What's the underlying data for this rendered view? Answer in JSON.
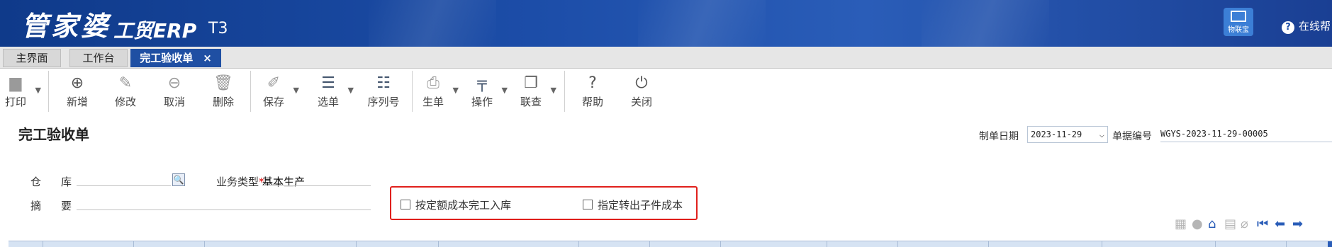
{
  "app": {
    "logo_main": "管家婆",
    "logo_sub": "工贸ERP",
    "logo_version": "T3",
    "iot_label": "物联宝",
    "online_help": "在线帮"
  },
  "tabs": [
    {
      "label": "主界面",
      "active": false
    },
    {
      "label": "工作台",
      "active": false
    },
    {
      "label": "完工验收单",
      "active": true,
      "close": "×"
    }
  ],
  "toolbar": [
    {
      "label": "打印",
      "icon": "printer-icon",
      "dropdown": true
    },
    {
      "label": "新增",
      "icon": "plus-circle-icon",
      "dropdown": false
    },
    {
      "label": "修改",
      "icon": "edit-icon",
      "dropdown": false
    },
    {
      "label": "取消",
      "icon": "minus-circle-icon",
      "dropdown": false
    },
    {
      "label": "删除",
      "icon": "trash-icon",
      "dropdown": false
    },
    {
      "label": "保存",
      "icon": "eraser-icon",
      "dropdown": true
    },
    {
      "label": "选单",
      "icon": "select-list-icon",
      "dropdown": true
    },
    {
      "label": "序列号",
      "icon": "serial-list-icon",
      "dropdown": false
    },
    {
      "label": "生单",
      "icon": "generate-doc-icon",
      "dropdown": true
    },
    {
      "label": "操作",
      "icon": "operation-icon",
      "dropdown": true
    },
    {
      "label": "联查",
      "icon": "linked-query-icon",
      "dropdown": true
    },
    {
      "label": "帮助",
      "icon": "help-icon",
      "dropdown": false
    },
    {
      "label": "关闭",
      "icon": "power-icon",
      "dropdown": false
    }
  ],
  "form": {
    "title": "完工验收单",
    "date_label": "制单日期",
    "date_value": "2023-11-29",
    "number_label": "单据编号",
    "number_value": "WGYS-2023-11-29-00005",
    "warehouse_label_1": "仓",
    "warehouse_label_2": "库",
    "warehouse_value": "",
    "summary_label_1": "摘",
    "summary_label_2": "要",
    "summary_value": "",
    "biztype_label": "业务类型",
    "required_mark": "*",
    "biztype_value": "基本生产",
    "options": [
      {
        "label": "按定额成本完工入库",
        "checked": false
      },
      {
        "label": "指定转出子件成本",
        "checked": false
      }
    ]
  },
  "colors": {
    "title_bar": "#1c4da8",
    "active_tab": "#1f4fa3",
    "highlight_border": "#e0201c",
    "grid_header": "#d6e3f3"
  }
}
